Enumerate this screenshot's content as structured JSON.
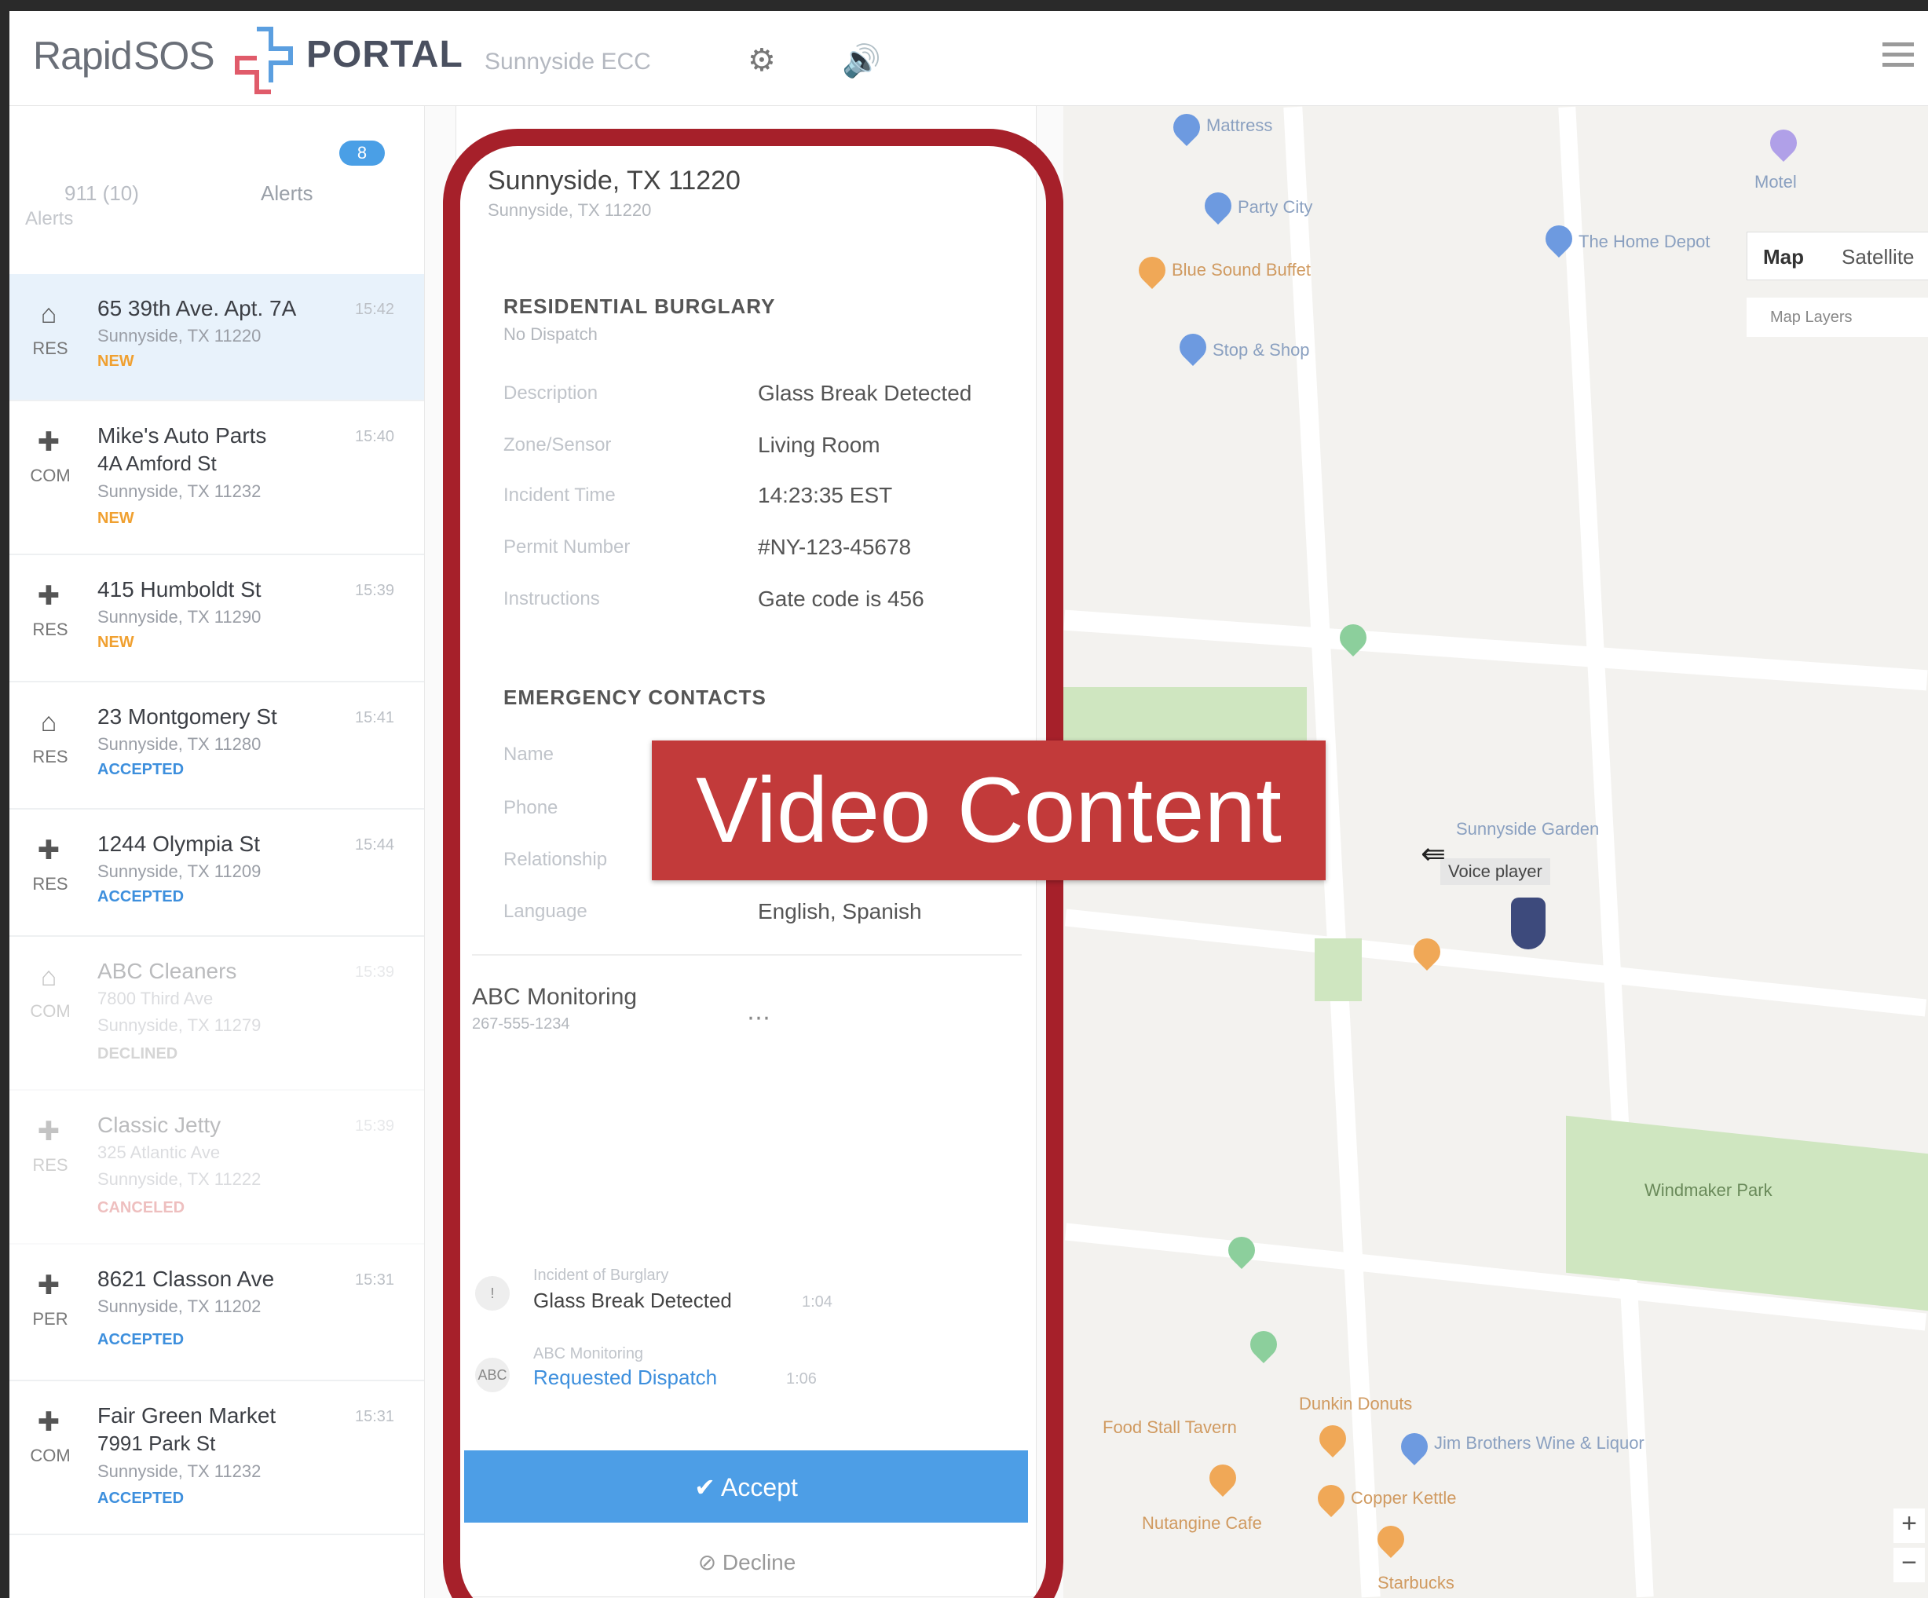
{
  "header": {
    "logo_left": "Rapid",
    "logo_mid": "SOS",
    "portal": "PORTAL",
    "psap_name": "Sunnyside ECC",
    "gear_icon": "gear-icon",
    "volume_icon": "volume-icon",
    "menu_icon": "hamburger-icon"
  },
  "sidebar": {
    "tab_911": "911 (10)",
    "tab_alerts": "Alerts",
    "alerts_count": "8",
    "filter_label": "Alerts",
    "items": [
      {
        "code": "RES",
        "title": "65 39th Ave. Apt. 7A",
        "sub": "Sunnyside, TX 11220",
        "sub2": "",
        "time": "15:42",
        "status": "NEW"
      },
      {
        "code": "COM",
        "title": "Mike's Auto Parts",
        "sub": "4A Amford St",
        "sub2": "Sunnyside, TX 11232",
        "time": "15:40",
        "status": "NEW"
      },
      {
        "code": "RES",
        "title": "415 Humboldt St",
        "sub": "Sunnyside, TX 11290",
        "sub2": "",
        "time": "15:39",
        "status": "NEW"
      },
      {
        "code": "RES",
        "title": "23 Montgomery St",
        "sub": "Sunnyside, TX 11280",
        "sub2": "",
        "time": "15:41",
        "status": "ACCEPTED"
      },
      {
        "code": "RES",
        "title": "1244 Olympia St",
        "sub": "Sunnyside, TX 11209",
        "sub2": "",
        "time": "15:44",
        "status": "ACCEPTED"
      },
      {
        "code": "COM",
        "title": "ABC Cleaners",
        "sub": "7800 Third Ave",
        "sub2": "Sunnyside, TX 11279",
        "time": "15:39",
        "status": "DECLINED"
      },
      {
        "code": "RES",
        "title": "Classic Jetty",
        "sub": "325 Atlantic Ave",
        "sub2": "Sunnyside, TX 11222",
        "time": "15:39",
        "status": "CANCELED"
      },
      {
        "code": "PER",
        "title": "8621 Classon Ave",
        "sub": "Sunnyside, TX 11202",
        "sub2": "",
        "time": "15:31",
        "status": "ACCEPTED"
      },
      {
        "code": "COM",
        "title": "Fair Green Market",
        "sub": "7991 Park St",
        "sub2": "Sunnyside, TX 11232",
        "time": "15:31",
        "status": "ACCEPTED"
      }
    ]
  },
  "detail": {
    "address": "Sunnyside, TX 11220",
    "address_sub": "Sunnyside, TX 11220",
    "section1_title": "RESIDENTIAL BURGLARY",
    "section1_sub": "No Dispatch",
    "fields": [
      {
        "label": "Description",
        "value": "Glass Break Detected"
      },
      {
        "label": "Zone/Sensor",
        "value": "Living Room"
      },
      {
        "label": "Incident Time",
        "value": "14:23:35 EST"
      },
      {
        "label": "Permit Number",
        "value": "#NY-123-45678"
      },
      {
        "label": "Instructions",
        "value": "Gate code is 456"
      }
    ],
    "section2_title": "EMERGENCY CONTACTS",
    "contacts": [
      {
        "label": "Name",
        "value": ""
      },
      {
        "label": "Phone",
        "value": ""
      },
      {
        "label": "Relationship",
        "value": ""
      },
      {
        "label": "Language",
        "value": "English, Spanish"
      }
    ],
    "org_name": "ABC Monitoring",
    "org_phone": "267-555-1234",
    "more": "⋯",
    "timeline": [
      {
        "badge": "!",
        "small": "Incident of Burglary",
        "main": "Glass Break Detected",
        "time": "1:04",
        "link": false
      },
      {
        "badge": "ABC",
        "small": "ABC Monitoring",
        "main": "Requested Dispatch",
        "time": "1:06",
        "link": true
      }
    ],
    "accept_label": "✔  Accept",
    "decline_label": "⊘  Decline"
  },
  "map": {
    "view_map": "Map",
    "view_satellite": "Satellite",
    "layers_label": "Map Layers",
    "tooltip": "Voice player",
    "pois": [
      "Mattress",
      "Party City",
      "Blue Sound Buffet",
      "Stop & Shop",
      "The Home Depot",
      "Motel",
      "Sunnyside Garden",
      "Windmaker Park",
      "Dunkin Donuts",
      "Food Stall Tavern",
      "Jim Brothers Wine & Liquor",
      "Copper Kettle",
      "Nutangine Cafe",
      "Starbucks"
    ],
    "zoom_in": "+",
    "zoom_out": "−"
  },
  "overlay": {
    "video_label": "Video Content"
  }
}
